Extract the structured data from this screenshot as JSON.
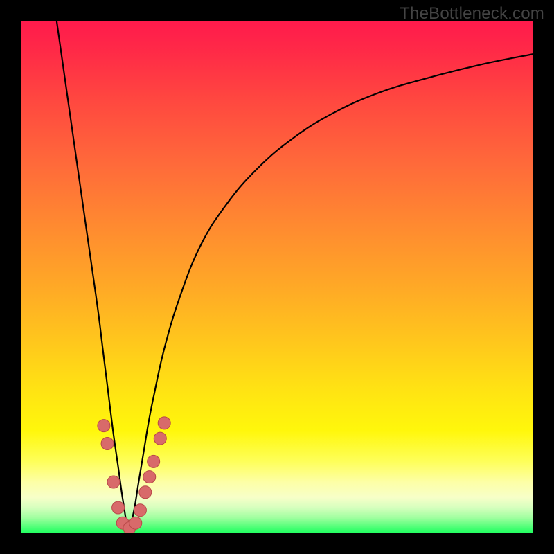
{
  "watermark": "TheBottleneck.com",
  "colors": {
    "background_black": "#000000",
    "curve_stroke": "#000000",
    "dot_fill": "#d86a6a",
    "dot_stroke": "#b84848",
    "gradient_top": "#ff1a4c",
    "gradient_bottom": "#1dff5e"
  },
  "chart_data": {
    "type": "line",
    "title": "",
    "xlabel": "",
    "ylabel": "",
    "xlim": [
      0,
      100
    ],
    "ylim": [
      0,
      100
    ],
    "note": "Axes unlabeled in source image; x and y interpreted as percent of plot width/height. y=0 at bottom (green), y=100 at top (red). Curve is an absolute-value V at x≈21 rising toward both edges.",
    "series": [
      {
        "name": "curve",
        "x": [
          7,
          9,
          11,
          13,
          15,
          16,
          17,
          18,
          19,
          20,
          21,
          22,
          23,
          24,
          25,
          26,
          28,
          31,
          35,
          40,
          46,
          53,
          61,
          70,
          80,
          90,
          100
        ],
        "y": [
          100,
          86,
          72,
          58,
          44,
          36,
          28,
          20,
          13,
          6,
          1,
          4,
          10,
          16,
          22,
          27,
          36,
          46,
          56,
          64,
          71,
          77,
          82,
          86,
          89,
          91.5,
          93.5
        ]
      }
    ],
    "markers": [
      {
        "name": "bead",
        "x": 16.2,
        "y": 21
      },
      {
        "name": "bead",
        "x": 16.9,
        "y": 17.5
      },
      {
        "name": "bead",
        "x": 18.1,
        "y": 10
      },
      {
        "name": "bead",
        "x": 19.0,
        "y": 5
      },
      {
        "name": "bead",
        "x": 19.9,
        "y": 2
      },
      {
        "name": "bead",
        "x": 21.2,
        "y": 1
      },
      {
        "name": "bead",
        "x": 22.4,
        "y": 2
      },
      {
        "name": "bead",
        "x": 23.3,
        "y": 4.5
      },
      {
        "name": "bead",
        "x": 24.3,
        "y": 8
      },
      {
        "name": "bead",
        "x": 25.1,
        "y": 11
      },
      {
        "name": "bead",
        "x": 25.9,
        "y": 14
      },
      {
        "name": "bead",
        "x": 27.2,
        "y": 18.5
      },
      {
        "name": "bead",
        "x": 28.0,
        "y": 21.5
      }
    ],
    "marker_radius_px": 9
  }
}
